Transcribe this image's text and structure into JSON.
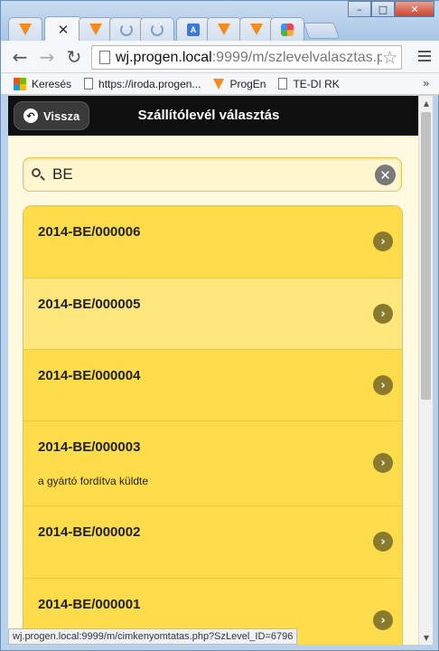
{
  "browser": {
    "tabs": [
      {
        "icon": "v-logo-icon",
        "active": false
      },
      {
        "icon": "close-icon",
        "active": true
      },
      {
        "icon": "v-logo-icon",
        "active": false
      },
      {
        "icon": "loading-icon",
        "active": false
      },
      {
        "icon": "loading-icon",
        "active": false
      },
      {
        "icon": "translate-icon",
        "active": false
      },
      {
        "icon": "v-logo-icon",
        "active": false
      },
      {
        "icon": "v-logo-icon",
        "active": false
      },
      {
        "icon": "joomla-icon",
        "active": false
      }
    ],
    "window_buttons": {
      "minimize": "–",
      "maximize": "□",
      "close": "✕"
    },
    "url": {
      "host": "wj.progen.local",
      "rest": ":9999/m/szlevelvalasztas.p"
    },
    "bookmarks": [
      {
        "label": "Keresés",
        "icon": "ms-logo-icon"
      },
      {
        "label": "https://iroda.progen...",
        "icon": "page-icon"
      },
      {
        "label": "ProgEn",
        "icon": "v-logo-icon"
      },
      {
        "label": "TE-DI RK",
        "icon": "page-icon"
      }
    ],
    "bookmarks_more": "»",
    "status_url": "wj.progen.local:9999/m/cimkenyomtatas.php?SzLevel_ID=6796"
  },
  "page": {
    "back_label": "Vissza",
    "title": "Szállítólevél választás",
    "search": {
      "value": "BE",
      "placeholder": ""
    },
    "items": [
      {
        "title": "2014-BE/000006",
        "subtitle": ""
      },
      {
        "title": "2014-BE/000005",
        "subtitle": ""
      },
      {
        "title": "2014-BE/000004",
        "subtitle": ""
      },
      {
        "title": "2014-BE/000003",
        "subtitle": "a gyártó fordítva küldte"
      },
      {
        "title": "2014-BE/000002",
        "subtitle": ""
      },
      {
        "title": "2014-BE/000001",
        "subtitle": ""
      }
    ]
  },
  "colors": {
    "header_bg": "#101010",
    "row_bg": "#fcdc4a",
    "row_highlight_bg": "#fde67c",
    "page_bg": "#fff9e0",
    "accent_orange": "#f58a1f"
  }
}
